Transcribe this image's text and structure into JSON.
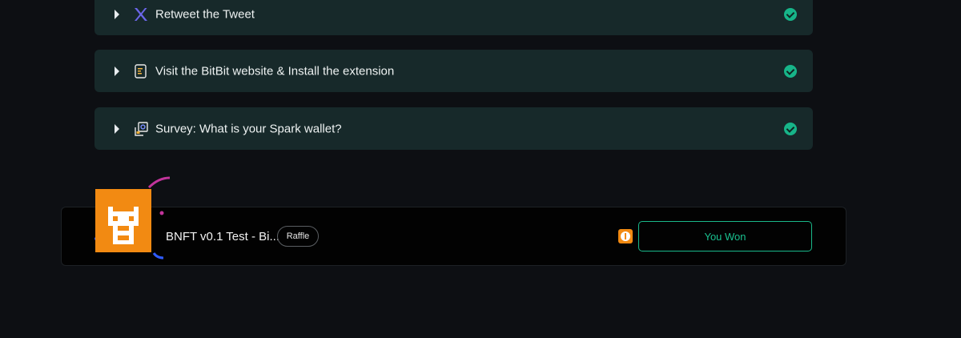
{
  "tasks": [
    {
      "label": "Retweet the Tweet",
      "icon": "x-logo-icon",
      "completed": true
    },
    {
      "label": "Visit the BitBit website & Install the extension",
      "icon": "document-icon",
      "completed": true
    },
    {
      "label": "Survey: What is your Spark wallet?",
      "icon": "survey-icon",
      "completed": true
    }
  ],
  "prize": {
    "title": "BNFT v0.1 Test - Bi...",
    "badge": "Raffle",
    "status_button": "You Won",
    "avatar_icon": "pixel-robot-icon",
    "info_icon": "info-icon"
  },
  "colors": {
    "background": "#0d0f13",
    "task_card": "#17292a",
    "check": "#17b589",
    "accent_orange": "#f28a12",
    "won_green": "#19c08f",
    "x_icon": "#6b66e8",
    "confetti_pink": "#c2349b",
    "confetti_blue": "#2f5bff"
  }
}
